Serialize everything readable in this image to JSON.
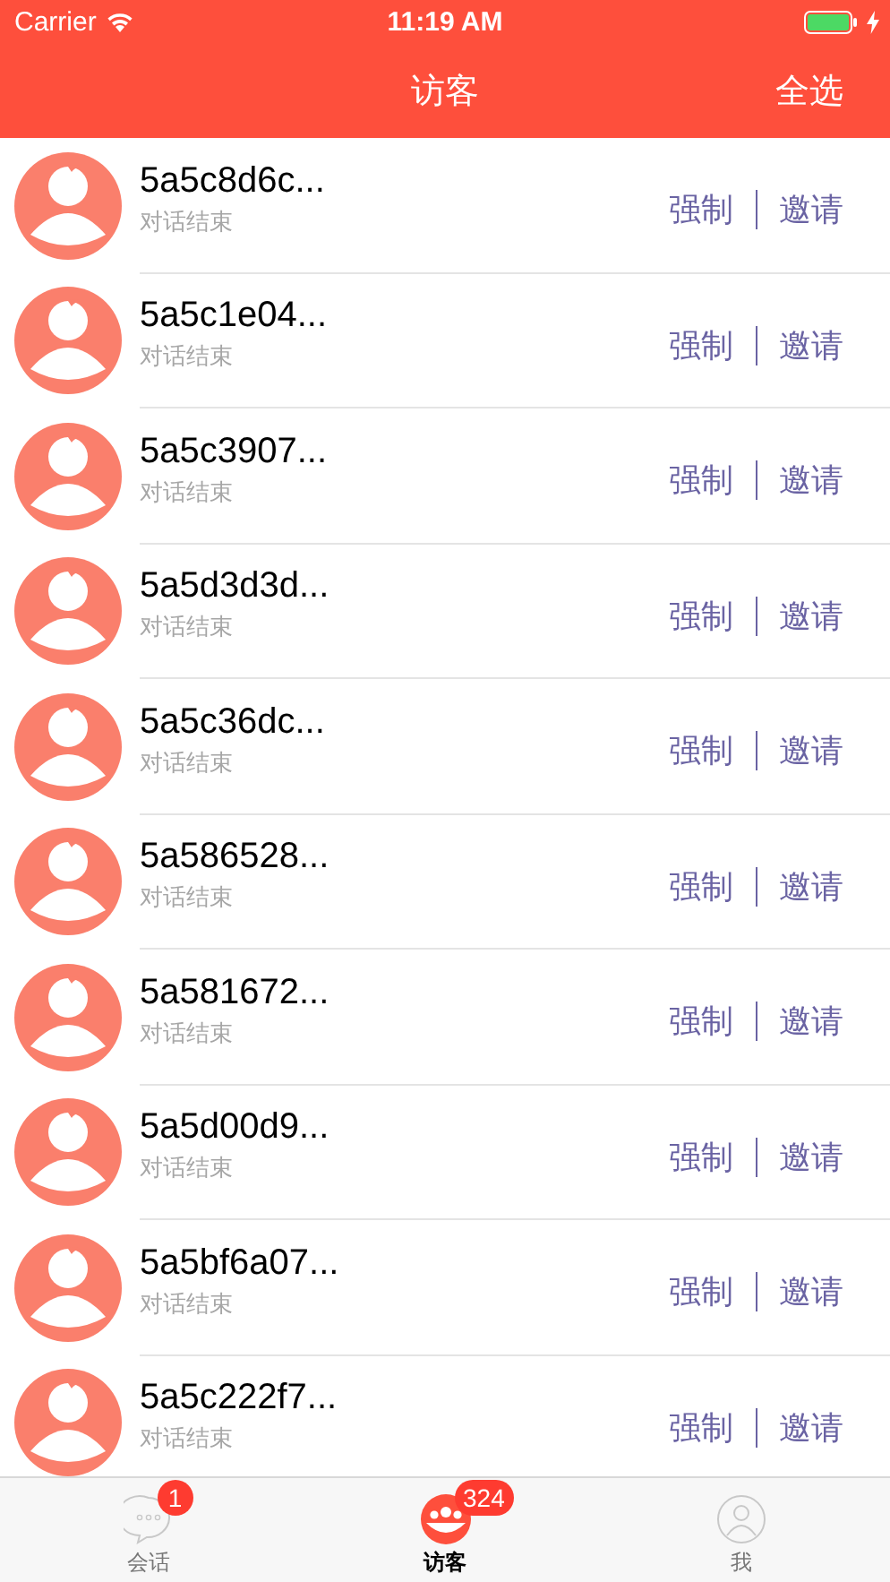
{
  "status_bar": {
    "carrier": "Carrier",
    "time": "11:19 AM",
    "battery_charging": true
  },
  "nav_bar": {
    "title": "访客",
    "action": "全选"
  },
  "visitors": [
    {
      "name": "5a5c8d6c...",
      "status": "对话结束",
      "actions": [
        "强制",
        "邀请"
      ]
    },
    {
      "name": "5a5c1e04...",
      "status": "对话结束",
      "actions": [
        "强制",
        "邀请"
      ]
    },
    {
      "name": "5a5c3907...",
      "status": "对话结束",
      "actions": [
        "强制",
        "邀请"
      ]
    },
    {
      "name": "5a5d3d3d...",
      "status": "对话结束",
      "actions": [
        "强制",
        "邀请"
      ]
    },
    {
      "name": "5a5c36dc...",
      "status": "对话结束",
      "actions": [
        "强制",
        "邀请"
      ]
    },
    {
      "name": "5a586528...",
      "status": "对话结束",
      "actions": [
        "强制",
        "邀请"
      ]
    },
    {
      "name": "5a581672...",
      "status": "对话结束",
      "actions": [
        "强制",
        "邀请"
      ]
    },
    {
      "name": "5a5d00d9...",
      "status": "对话结束",
      "actions": [
        "强制",
        "邀请"
      ]
    },
    {
      "name": "5a5bf6a07...",
      "status": "对话结束",
      "actions": [
        "强制",
        "邀请"
      ]
    },
    {
      "name": "5a5c222f7...",
      "status": "对话结束",
      "actions": [
        "强制",
        "邀请"
      ]
    }
  ],
  "tab_bar": [
    {
      "label": "会话",
      "kind": "chat",
      "badge": "1",
      "selected": false
    },
    {
      "label": "访客",
      "kind": "visitors",
      "badge": "324",
      "selected": true
    },
    {
      "label": "我",
      "kind": "me",
      "selected": false
    }
  ]
}
